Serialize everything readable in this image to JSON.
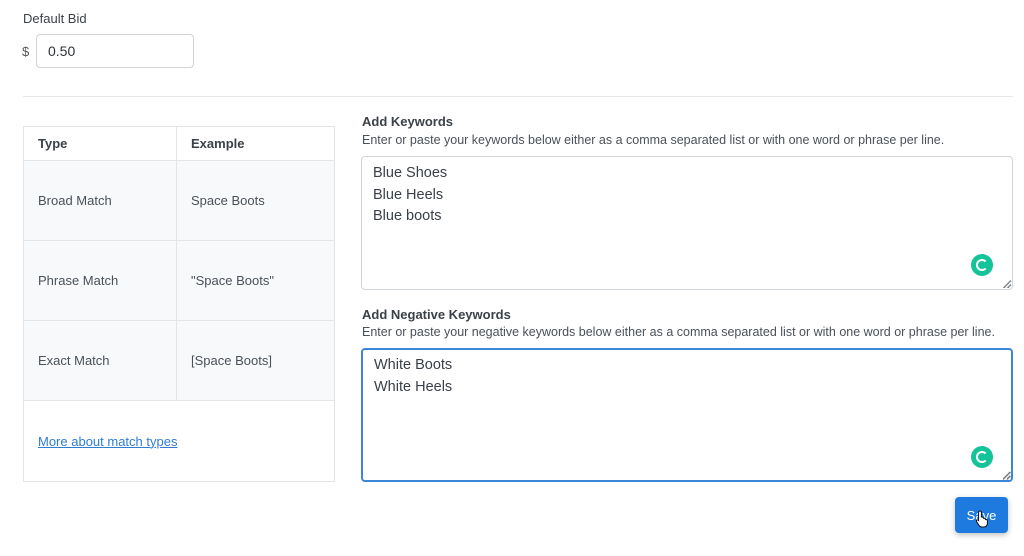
{
  "bid": {
    "label": "Default Bid",
    "currency_symbol": "$",
    "value": "0.50"
  },
  "match_types": {
    "headers": [
      "Type",
      "Example"
    ],
    "rows": [
      {
        "type": "Broad Match",
        "example": "Space Boots"
      },
      {
        "type": "Phrase Match",
        "example": "\"Space Boots\""
      },
      {
        "type": "Exact Match",
        "example": "[Space Boots]"
      }
    ],
    "link_label": "More about match types"
  },
  "keywords": {
    "heading": "Add Keywords",
    "help": "Enter or paste your keywords below either as a comma separated list or with one word or phrase per line.",
    "value": "Blue Shoes\nBlue Heels\nBlue boots"
  },
  "negative_keywords": {
    "heading": "Add Negative Keywords",
    "help": "Enter or paste your negative keywords below either as a comma separated list or with one word or phrase per line.",
    "value": "White Boots\nWhite Heels"
  },
  "save_label": "Save",
  "colors": {
    "accent": "#1f7ae0",
    "link": "#2f7dd1",
    "grammarly": "#15c39a",
    "focus_border": "#3d86d6"
  }
}
